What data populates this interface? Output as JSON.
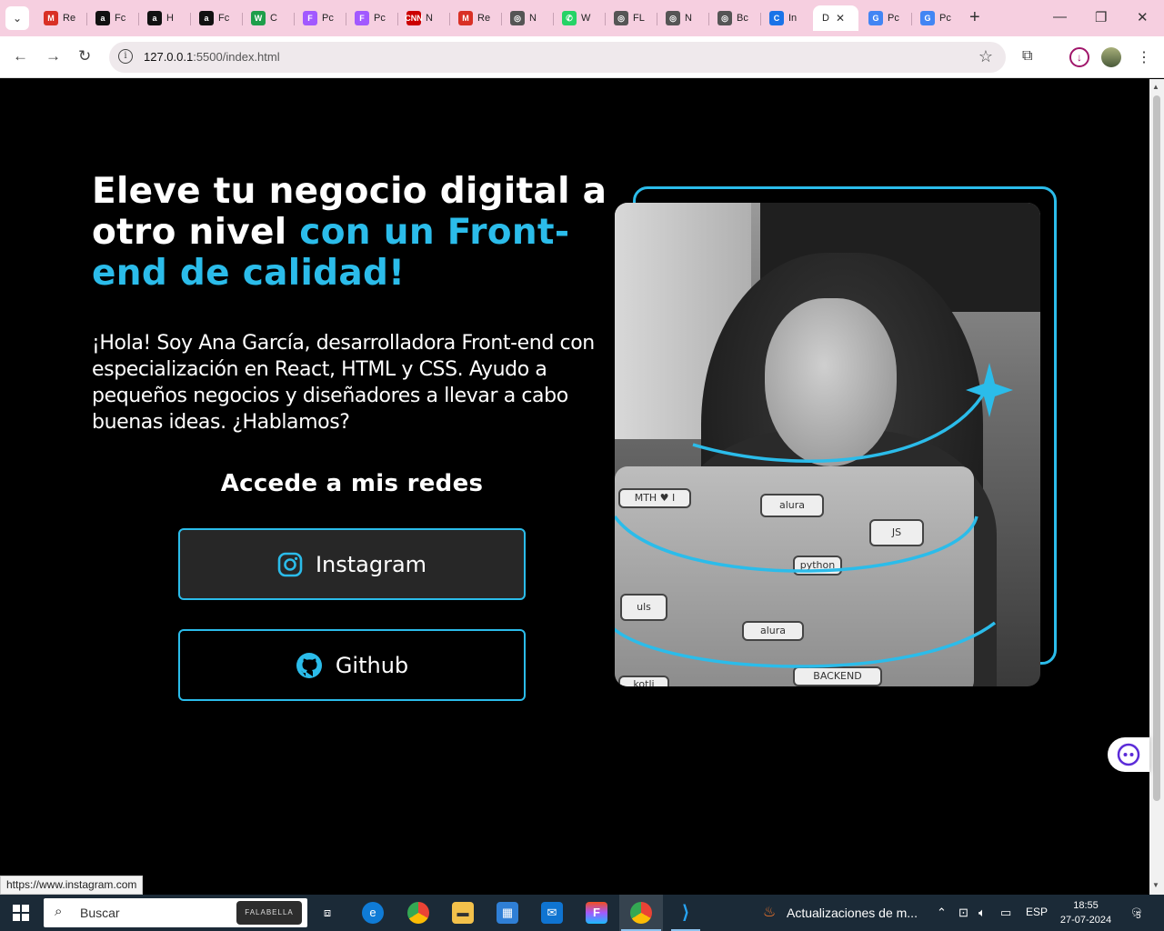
{
  "browser": {
    "tabs": [
      {
        "favicon": "M",
        "color": "#d93025",
        "label": "Re"
      },
      {
        "favicon": "a",
        "color": "#111111",
        "label": "Fc"
      },
      {
        "favicon": "a",
        "color": "#111111",
        "label": "H"
      },
      {
        "favicon": "a",
        "color": "#111111",
        "label": "Fc"
      },
      {
        "favicon": "W",
        "color": "#1e9e4a",
        "label": "C"
      },
      {
        "favicon": "F",
        "color": "#a259ff",
        "label": "Pc"
      },
      {
        "favicon": "F",
        "color": "#a259ff",
        "label": "Pc"
      },
      {
        "favicon": "CNN",
        "color": "#cc0000",
        "label": "N"
      },
      {
        "favicon": "M",
        "color": "#d93025",
        "label": "Re"
      },
      {
        "favicon": "◎",
        "color": "#555555",
        "label": "N"
      },
      {
        "favicon": "✆",
        "color": "#25d366",
        "label": "W"
      },
      {
        "favicon": "◎",
        "color": "#555555",
        "label": "FL"
      },
      {
        "favicon": "◎",
        "color": "#555555",
        "label": "N"
      },
      {
        "favicon": "◎",
        "color": "#555555",
        "label": "Bc"
      },
      {
        "favicon": "C",
        "color": "#1a73e8",
        "label": "In"
      },
      {
        "favicon": "",
        "color": "#ffffff",
        "label": "D",
        "active": true
      },
      {
        "favicon": "G",
        "color": "#4285f4",
        "label": "Pc"
      },
      {
        "favicon": "G",
        "color": "#4285f4",
        "label": "Pc"
      }
    ],
    "url_host": "127.0.0.1",
    "url_path": ":5500/index.html",
    "status_url": "https://www.instagram.com"
  },
  "page": {
    "headline_plain": "Eleve tu negocio digital a otro nivel ",
    "headline_highlight": "con un Front-end de calidad!",
    "intro": "¡Hola! Soy Ana García, desarrolladora Front-end con especialización en React, HTML y CSS. Ayudo a pequeños negocios y diseñadores a llevar a cabo buenas ideas. ¿Hablamos?",
    "redes_title": "Accede a mis redes",
    "buttons": [
      {
        "label": "Instagram",
        "icon": "instagram-icon"
      },
      {
        "label": "Github",
        "icon": "github-icon"
      }
    ],
    "photo_sticker_texts": [
      "MTH ♥ I",
      "alura",
      "JS",
      "python",
      "alura",
      "BACKEND",
      "uls",
      "kotli"
    ],
    "accent_color": "#2bbcea"
  },
  "taskbar": {
    "search_placeholder": "Buscar",
    "search_promo": "FALABELLA",
    "notification": "Actualizaciones de m...",
    "language": "ESP",
    "time": "18:55",
    "date": "27-07-2024",
    "notif_count": "5"
  }
}
